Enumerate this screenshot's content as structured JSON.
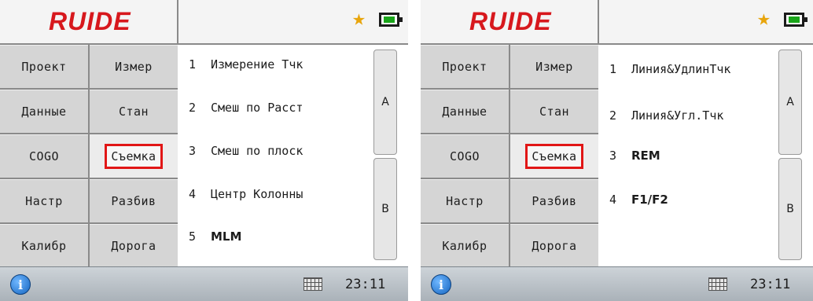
{
  "header": {
    "logo": "RUIDE"
  },
  "colors": {
    "accent_red": "#e11616",
    "logo_red": "#d7181d",
    "star": "#e8a50c",
    "battery": "#1aa51a"
  },
  "icons": {
    "favorite": "star-icon",
    "battery": "battery-icon",
    "info": "info-icon",
    "keyboard": "keyboard-icon"
  },
  "left_screen": {
    "menu": {
      "project": "Проект",
      "measure": "Измер",
      "data": "Данные",
      "station": "Стан",
      "cogo": "COGO",
      "survey": "Съемка",
      "settings": "Настр",
      "stakeout": "Разбив",
      "calib": "Калибр",
      "road": "Дорога"
    },
    "selected_menu": "Съемка",
    "items": [
      {
        "num": "1",
        "label": "Измерение Тчк"
      },
      {
        "num": "2",
        "label": "Смеш по Расст"
      },
      {
        "num": "3",
        "label": "Смеш по плоск"
      },
      {
        "num": "4",
        "label": "Центр Колонны"
      },
      {
        "num": "5",
        "label": "MLM"
      }
    ],
    "tabs": {
      "upper": "A",
      "lower": "B"
    },
    "clock": "23:11"
  },
  "right_screen": {
    "menu": {
      "project": "Проект",
      "measure": "Измер",
      "data": "Данные",
      "station": "Стан",
      "cogo": "COGO",
      "survey": "Съемка",
      "settings": "Настр",
      "stakeout": "Разбив",
      "calib": "Калибр",
      "road": "Дорога"
    },
    "selected_menu": "Съемка",
    "items": [
      {
        "num": "1",
        "label": "Линия&УдлинТчк"
      },
      {
        "num": "2",
        "label": "Линия&Угл.Тчк"
      },
      {
        "num": "3",
        "label": "REM"
      },
      {
        "num": "4",
        "label": "F1/F2"
      }
    ],
    "tabs": {
      "upper": "A",
      "lower": "B"
    },
    "clock": "23:11"
  }
}
